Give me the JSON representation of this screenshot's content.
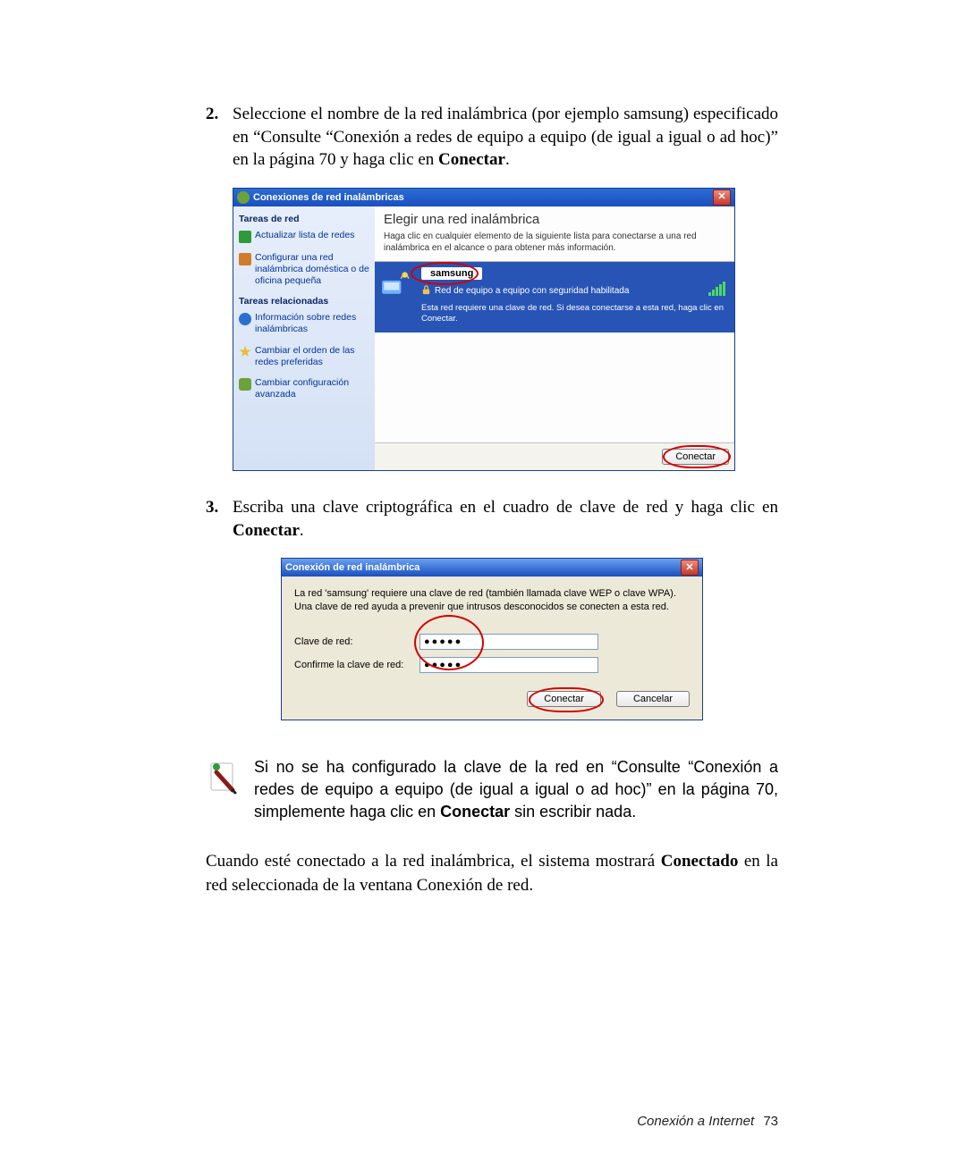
{
  "step2": {
    "num": "2.",
    "text_a": "Seleccione el nombre de la red inalámbrica (por ejemplo samsung) especificado en “Consulte “Conexión a redes de equipo a equipo (de igual a igual o ad hoc)” en la página 70 y haga clic en ",
    "text_bold": "Conectar",
    "text_b": "."
  },
  "win1": {
    "title": "Conexiones de red inalámbricas",
    "sidebar": {
      "hdr1": "Tareas de red",
      "refresh": "Actualizar lista de redes",
      "setup": "Configurar una red inalámbrica doméstica o de oficina pequeña",
      "hdr2": "Tareas relacionadas",
      "learn": "Información sobre redes inalámbricas",
      "order": "Cambiar el orden de las redes preferidas",
      "advanced": "Cambiar configuración avanzada"
    },
    "main": {
      "header": "Elegir una red inalámbrica",
      "sub": "Haga clic en cualquier elemento de la siguiente lista para conectarse a una red inalámbrica en el alcance o para obtener más información.",
      "ssid": "samsung",
      "desc": "Red de equipo a equipo con seguridad habilitada",
      "note": "Esta red requiere una clave de red. Si desea conectarse a esta red, haga clic en Conectar."
    },
    "connect": "Conectar"
  },
  "step3": {
    "num": "3.",
    "text_a": "Escriba una clave criptográfica en el cuadro de clave de red y haga clic en ",
    "text_bold": "Conectar",
    "text_b": "."
  },
  "win2": {
    "title": "Conexión de red inalámbrica",
    "desc": "La red 'samsung' requiere una clave de red (también llamada clave WEP o clave WPA). Una clave de red ayuda a prevenir que intrusos desconocidos se conecten a esta red.",
    "label_key": "Clave de red:",
    "label_confirm": "Confirme la clave de red:",
    "value": "●●●●●",
    "connect": "Conectar",
    "cancel": "Cancelar"
  },
  "note": {
    "text_a": "Si no se ha configurado la clave de la red en “Consulte “Conexión a redes de equipo a equipo (de igual a igual o ad hoc)” en la página 70, simplemente haga clic en ",
    "bold": "Conectar",
    "text_b": " sin escribir nada."
  },
  "para": {
    "a": "Cuando esté conectado a la red inalámbrica, el sistema mostrará ",
    "bold": "Conectado",
    "b": " en la red seleccionada de la ventana Conexión de red."
  },
  "footer": {
    "label": "Conexión a Internet",
    "page": "73"
  }
}
